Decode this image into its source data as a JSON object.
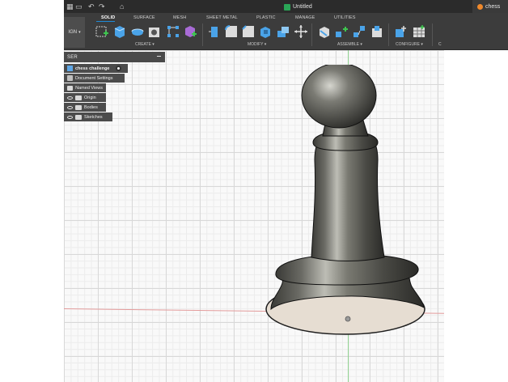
{
  "titlebar": {
    "undo_icon": "undo-icon",
    "redo_icon": "redo-icon",
    "home_icon": "home-icon",
    "document_title": "Untitled",
    "other_tab_title": "chess"
  },
  "ribbon": {
    "workspace_label": "IGN",
    "tabs": [
      "SOLID",
      "SURFACE",
      "MESH",
      "SHEET METAL",
      "PLASTIC",
      "MANAGE",
      "UTILITIES"
    ],
    "groups": [
      "CREATE",
      "MODIFY",
      "ASSEMBLE",
      "CONFIGURE",
      "C"
    ]
  },
  "browser": {
    "title": "SER",
    "items": [
      {
        "label": "chess challenge"
      },
      {
        "label": "Document Settings"
      },
      {
        "label": "Named Views"
      },
      {
        "label": "Origin"
      },
      {
        "label": "Bodies"
      },
      {
        "label": "Sketches"
      }
    ]
  },
  "colors": {
    "ribbon_bg": "#3c3c3c",
    "titlebar_bg": "#2b2b2b",
    "accent_blue": "#1f8ad6",
    "axis_x": "#e39b9b",
    "axis_y": "#8fd18f"
  }
}
